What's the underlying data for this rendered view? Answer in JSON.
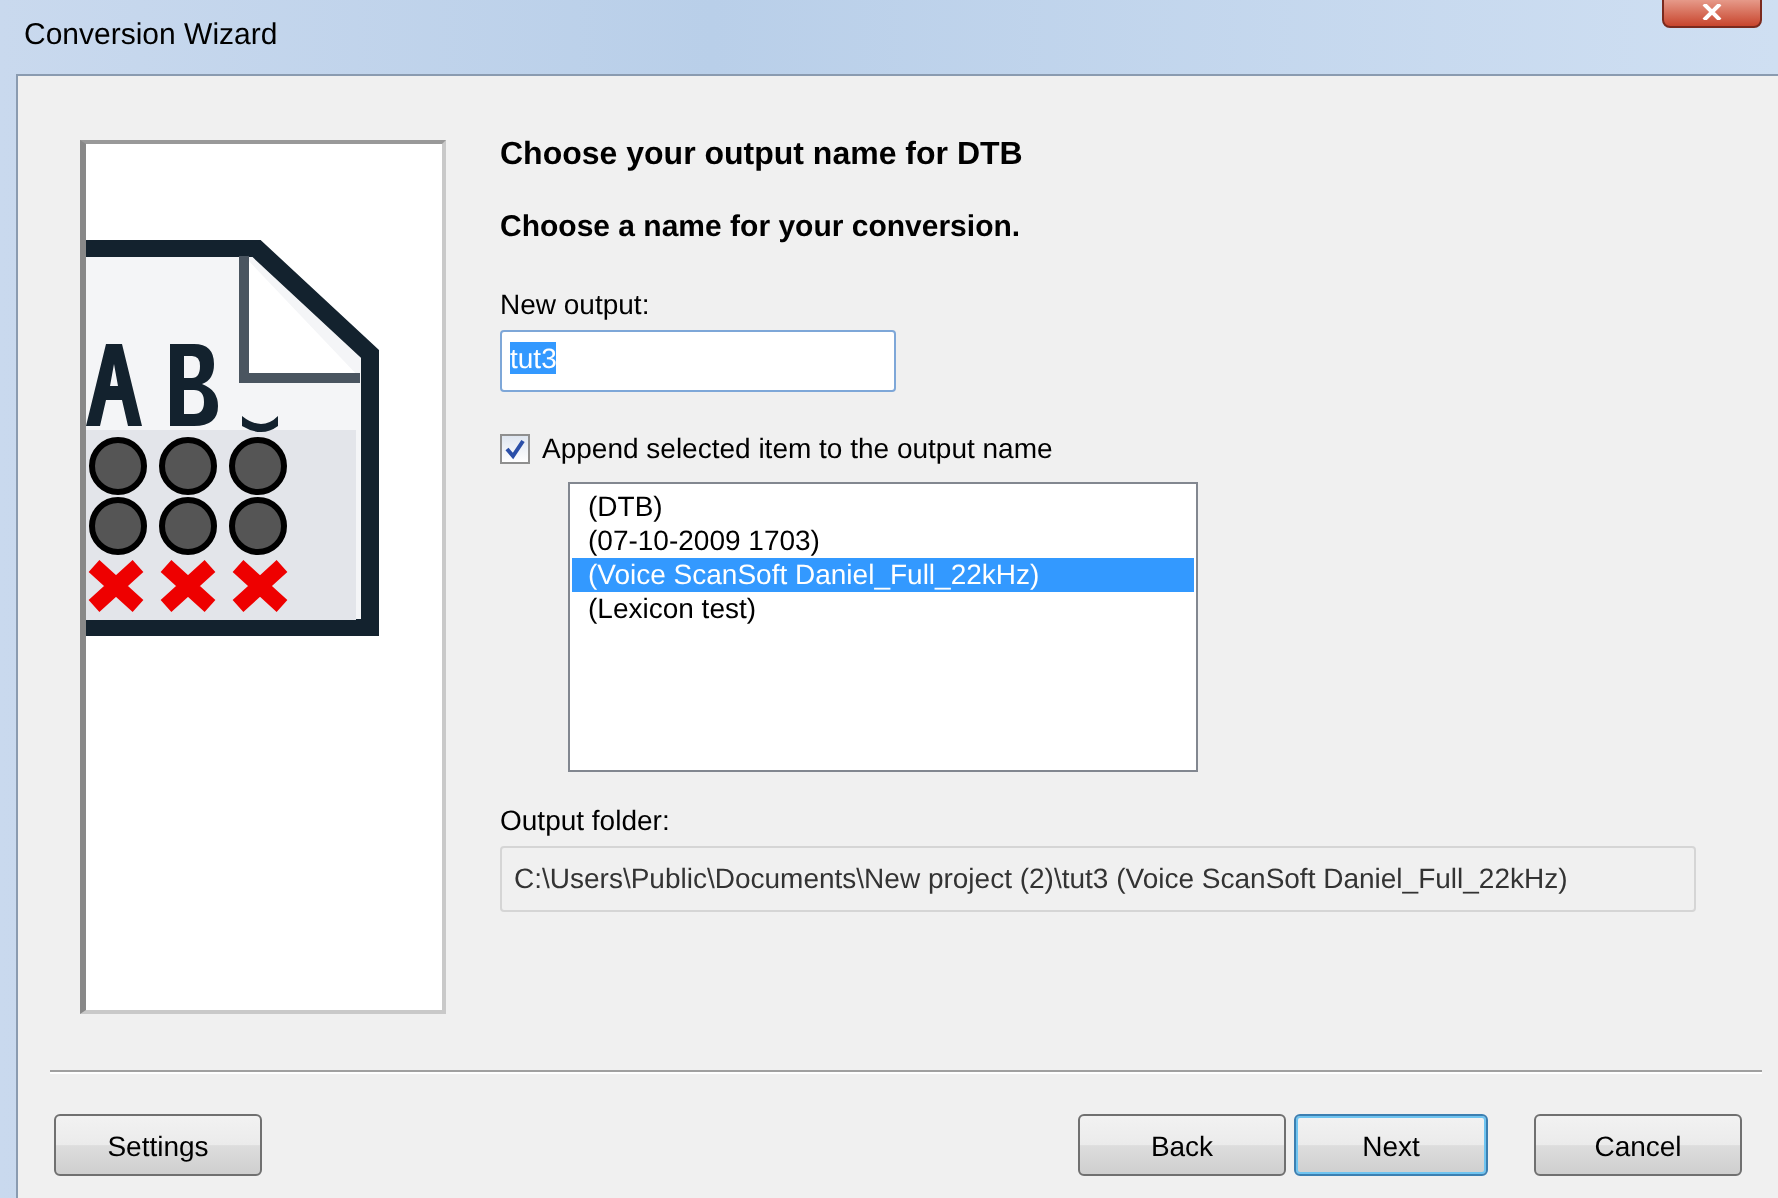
{
  "window": {
    "title": "Conversion Wizard"
  },
  "heading": "Choose your output name for DTB",
  "subheading": "Choose a name for your conversion.",
  "output_name": {
    "label": "New output:",
    "value": "tut3",
    "text_selected": true
  },
  "append_option": {
    "label": "Append selected item to the output name",
    "checked": true
  },
  "items": [
    {
      "label": "(DTB)",
      "selected": false
    },
    {
      "label": "(07-10-2009 1703)",
      "selected": false
    },
    {
      "label": "(Voice ScanSoft Daniel_Full_22kHz)",
      "selected": true
    },
    {
      "label": "(Lexicon test)",
      "selected": false
    }
  ],
  "output_folder": {
    "label": "Output folder:",
    "value": "C:\\Users\\Public\\Documents\\New project (2)\\tut3 (Voice ScanSoft Daniel_Full_22kHz)"
  },
  "buttons": [
    {
      "label": "Settings",
      "kind": "left",
      "default": false
    },
    {
      "label": "Back",
      "kind": "right",
      "default": false
    },
    {
      "label": "Next",
      "kind": "right",
      "default": true
    },
    {
      "label": "Cancel",
      "kind": "right",
      "default": false
    }
  ]
}
